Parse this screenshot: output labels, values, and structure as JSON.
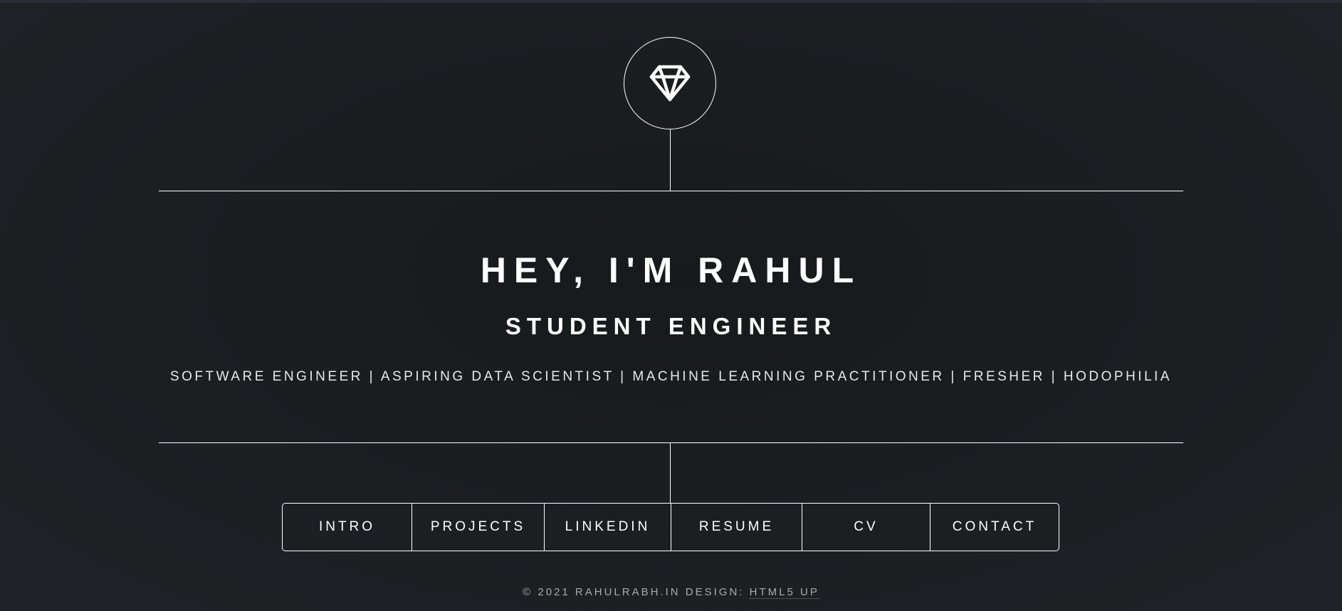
{
  "header": {
    "logo_icon": "diamond-icon"
  },
  "intro": {
    "title": "HEY, I'M RAHUL",
    "subtitle": "STUDENT ENGINEER",
    "tagline": "SOFTWARE ENGINEER | ASPIRING DATA SCIENTIST | MACHINE LEARNING PRACTITIONER | FRESHER | HODOPHILIA"
  },
  "nav": {
    "items": [
      {
        "label": "INTRO"
      },
      {
        "label": "PROJECTS"
      },
      {
        "label": "LINKEDIN"
      },
      {
        "label": "RESUME"
      },
      {
        "label": "CV"
      },
      {
        "label": "CONTACT"
      }
    ]
  },
  "footer": {
    "copyright": "© 2021 RAHULRABH.IN DESIGN:",
    "design_link": "HTML5 UP"
  },
  "colors": {
    "background": "#1b1e21",
    "foreground": "#ffffff",
    "muted": "#a9abae"
  }
}
